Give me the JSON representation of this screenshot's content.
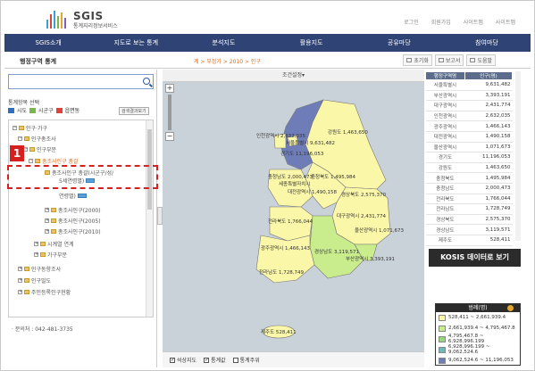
{
  "header": {
    "logo_title": "SGIS",
    "logo_sub": "통계지리정보서비스",
    "top_links": [
      "로그인",
      "회원가입",
      "사이트맵",
      "사이트맵"
    ],
    "nav": [
      "SGIS소개",
      "지도로 보는 통계",
      "분석지도",
      "활용지도",
      "공유마당",
      "참여마당"
    ]
  },
  "panel": {
    "title": "행정구역 통계",
    "breadcrumb": "계 > 부정가 > 2010 > 인구",
    "tools": [
      "초기화",
      "보고서",
      "도움말"
    ],
    "condition": "조건설정▾"
  },
  "left": {
    "items_label": "통계항목 선택",
    "legend": [
      "시도",
      "시군구",
      "읍면동"
    ],
    "search_btn": "검색결과보기",
    "tree": [
      "인구·가구",
      "인구총조사",
      "인구부문",
      "총조사인구 총괄",
      "총조사인구 총괄(시군구/성/",
      "5세연령별)",
      "연령별)",
      "총조사인구(2000)",
      "총조사인구(2005)",
      "총조사인구(2010)",
      "시계열 연계",
      "가구부문",
      "인구동향조사",
      "인구밀도",
      "주민등록인구현황"
    ],
    "phone": "· 문의처 : 042-481-3735",
    "badge": "1"
  },
  "map": {
    "region_labels": [
      "인천광역시 2,632,035",
      "서울특별시 9,631,482",
      "강원도 1,463,650",
      "경기도 11,196,053",
      "충청북도 1,495,984",
      "대전광역시 1,490,158",
      "세종특별자치시",
      "충청남도 2,000,473",
      "경상북도 2,575,370",
      "전라북도 1,766,044",
      "대구광역시 2,431,774",
      "울산광역시 1,071,673",
      "광주광역시 1,466,143",
      "경상남도 3,119,571",
      "부산광역시 3,393,191",
      "전라남도 1,728,749",
      "제주도 528,411"
    ],
    "bottom": [
      "석상지도",
      "통계값",
      "통계주위"
    ]
  },
  "table": {
    "headers": [
      "행정구역명",
      "인구(명)"
    ],
    "rows": [
      [
        "서울특별시",
        "9,631,482"
      ],
      [
        "부산광역시",
        "3,393,191"
      ],
      [
        "대구광역시",
        "2,431,774"
      ],
      [
        "인천광역시",
        "2,632,035"
      ],
      [
        "광주광역시",
        "1,466,143"
      ],
      [
        "대전광역시",
        "1,490,158"
      ],
      [
        "울산광역시",
        "1,071,673"
      ],
      [
        "경기도",
        "11,196,053"
      ],
      [
        "강원도",
        "1,463,650"
      ],
      [
        "충청북도",
        "1,495,984"
      ],
      [
        "충청남도",
        "2,000,473"
      ],
      [
        "전라북도",
        "1,766,044"
      ],
      [
        "전라남도",
        "1,728,749"
      ],
      [
        "경상북도",
        "2,575,370"
      ],
      [
        "경상남도",
        "3,119,571"
      ],
      [
        "제주도",
        "528,411"
      ]
    ]
  },
  "kosis": "KOSIS 데이터로 보기",
  "legend": {
    "title": "범례(명)",
    "items": [
      "528,411 ~ 2,661,939.4",
      "2,661,939.4 ~ 4,795,467.8",
      "4,795,467.8 ~ 6,928,996.199",
      "6,928,996.199 ~ 9,062,524.6",
      "9,062,524.6 ~ 11,196,053"
    ]
  },
  "colors": {
    "nav_bg": "#2f4375",
    "legend": [
      "#fbf7a8",
      "#c9ec8c",
      "#94d877",
      "#6fb9bd",
      "#6e7db8"
    ],
    "highlight": "#d62020"
  }
}
